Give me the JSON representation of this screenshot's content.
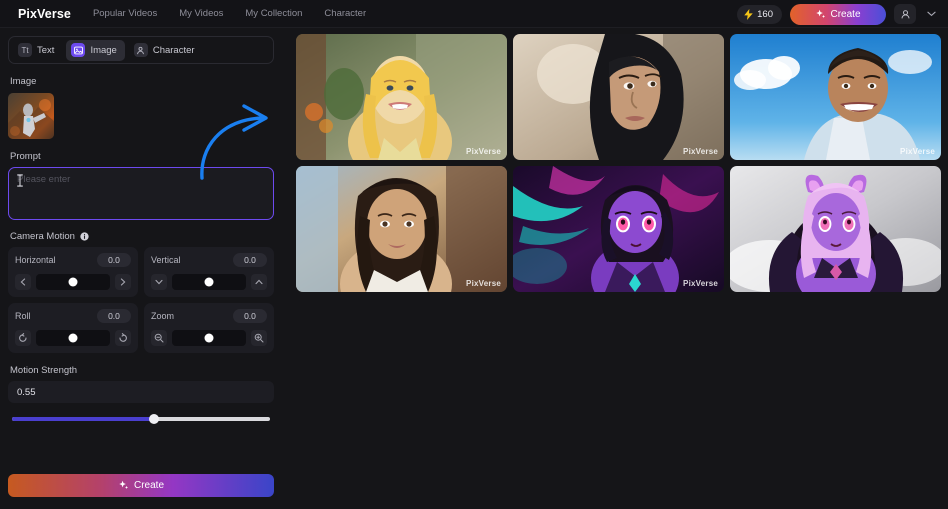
{
  "header": {
    "brand": "PixVerse",
    "nav": [
      {
        "label": "Popular Videos"
      },
      {
        "label": "My Videos"
      },
      {
        "label": "My Collection"
      },
      {
        "label": "Character"
      }
    ],
    "credits": {
      "icon": "lightning-bolt-icon",
      "value": "160"
    },
    "create_label": "Create",
    "avatar_icon": "user-avatar-icon",
    "chevron_icon": "chevron-down-icon"
  },
  "panel": {
    "tabs": [
      {
        "label": "Text",
        "icon": "text-icon",
        "glyph": "Tt",
        "active": false
      },
      {
        "label": "Image",
        "icon": "image-icon",
        "glyph": "▤",
        "active": true
      },
      {
        "label": "Character",
        "icon": "character-icon",
        "glyph": "☻",
        "active": false
      }
    ],
    "image_section_label": "Image",
    "thumbnail_name": "uploaded-image-thumbnail",
    "prompt_label": "Prompt",
    "prompt_placeholder": "Please enter",
    "prompt_value": "",
    "camera_motion_title": "Camera Motion",
    "camera_motion": [
      {
        "name": "Horizontal",
        "value": "0.0",
        "position": 50,
        "dec_icon": "chevron-left-icon",
        "inc_icon": "chevron-right-icon"
      },
      {
        "name": "Vertical",
        "value": "0.0",
        "position": 50,
        "dec_icon": "chevron-down-icon",
        "inc_icon": "chevron-up-icon"
      },
      {
        "name": "Roll",
        "value": "0.0",
        "position": 50,
        "dec_icon": "rotate-left-icon",
        "inc_icon": "rotate-right-icon"
      },
      {
        "name": "Zoom",
        "value": "0.0",
        "position": 50,
        "dec_icon": "zoom-out-icon",
        "inc_icon": "zoom-in-icon"
      }
    ],
    "motion_strength_label": "Motion Strength",
    "motion_strength_value": "0.55",
    "motion_strength_percent": 55,
    "create_label": "Create"
  },
  "gallery": {
    "watermark": "PixVerse",
    "tiles": [
      {
        "name": "tile-blonde-woman-smiling",
        "watermark": true
      },
      {
        "name": "tile-woman-black-headscarf",
        "watermark": true
      },
      {
        "name": "tile-man-blue-sky",
        "watermark": true
      },
      {
        "name": "tile-brunette-woman-portrait",
        "watermark": true
      },
      {
        "name": "tile-anime-girl-neon",
        "watermark": true
      },
      {
        "name": "tile-anime-girl-purple-hair",
        "watermark": false
      }
    ]
  },
  "annotation": {
    "name": "curved-arrow-annotation",
    "color": "#1a7ff0"
  },
  "colors": {
    "background": "#151518",
    "accent_purple": "#6d4aef",
    "slider_fill": "#4a3fcf",
    "arrow_blue": "#1a7ff0"
  }
}
